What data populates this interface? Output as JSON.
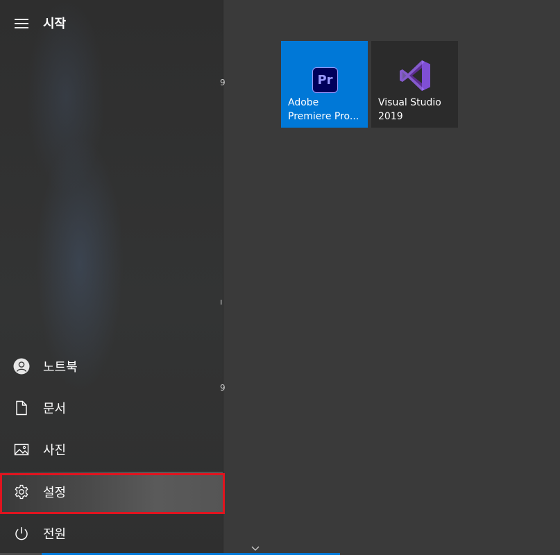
{
  "header": {
    "title": "시작",
    "menu_icon": "hamburger-menu-icon"
  },
  "nav": {
    "items": [
      {
        "label": "노트북",
        "icon": "user-account-icon"
      },
      {
        "label": "문서",
        "icon": "document-icon"
      },
      {
        "label": "사진",
        "icon": "pictures-icon"
      },
      {
        "label": "설정",
        "icon": "gear-icon",
        "highlighted": true
      },
      {
        "label": "전원",
        "icon": "power-icon"
      }
    ]
  },
  "tiles": [
    {
      "label": "Adobe\nPremiere Pro...",
      "logo_text": "Pr",
      "icon": "premiere-pro-icon",
      "color": "#0078d7"
    },
    {
      "label": "Visual Studio\n2019",
      "icon": "visual-studio-icon",
      "color": "#2b2b2b"
    }
  ],
  "edge_glyphs": [
    "9",
    "ı",
    "9"
  ],
  "colors": {
    "accent": "#0078d7",
    "highlight_border": "#e0141f",
    "nav_bg": "#2f2f2f",
    "tiles_bg": "#3a3a3a"
  }
}
